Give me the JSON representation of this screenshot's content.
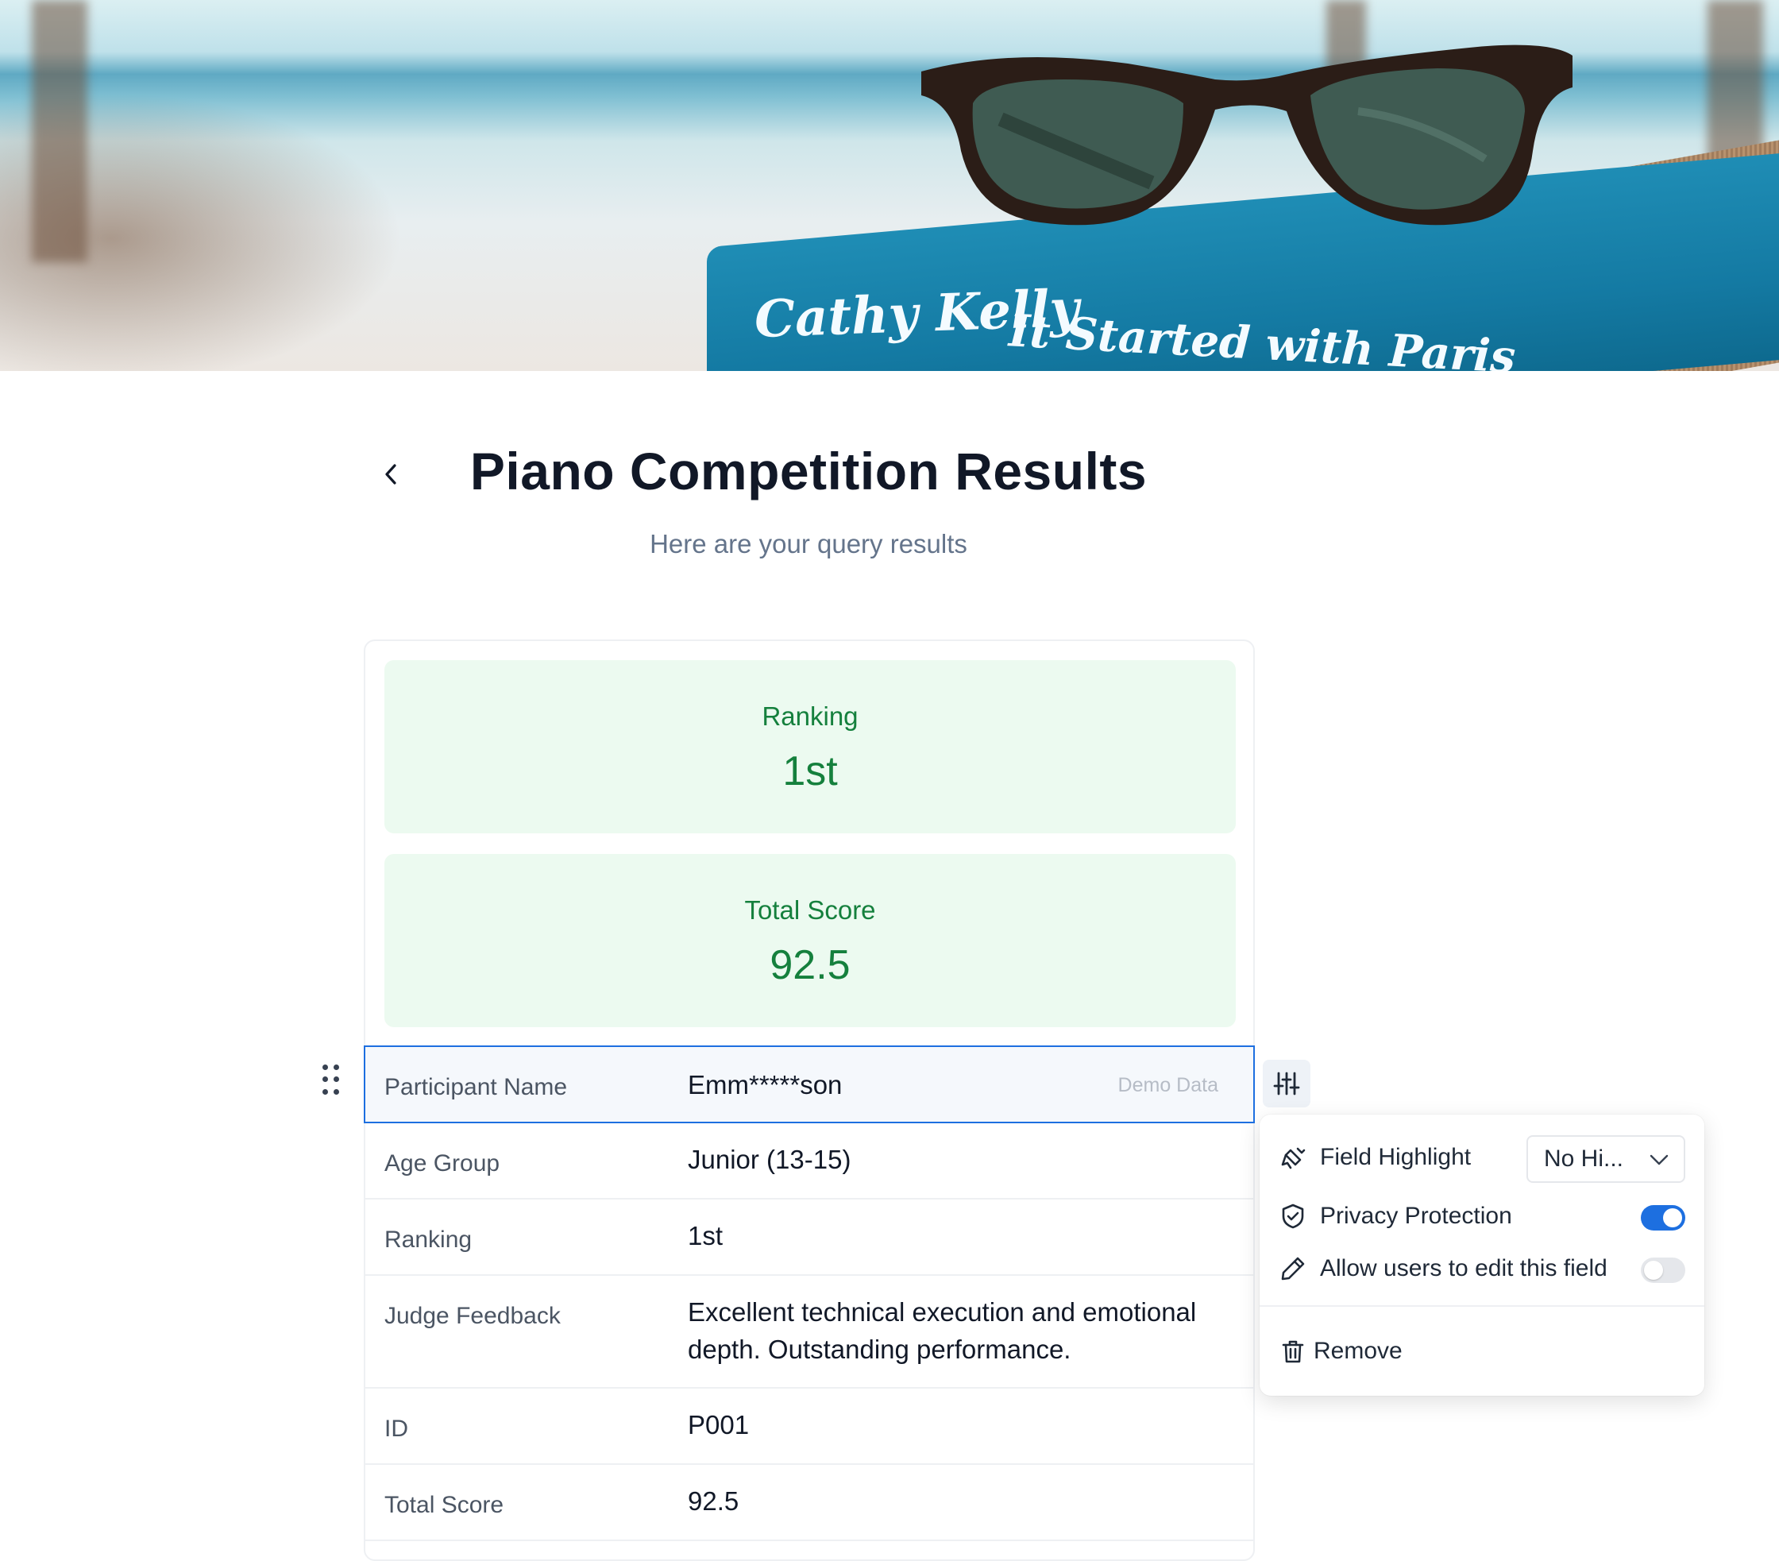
{
  "banner": {
    "book_author": "Cathy Kelly",
    "book_title": "It Started with Paris"
  },
  "header": {
    "title": "Piano Competition Results",
    "subtitle": "Here are your query results"
  },
  "stats": [
    {
      "label": "Ranking",
      "value": "1st"
    },
    {
      "label": "Total Score",
      "value": "92.5"
    }
  ],
  "fields": [
    {
      "label": "Participant Name",
      "value": "Emm*****son",
      "tag": "Demo Data"
    },
    {
      "label": "Age Group",
      "value": "Junior (13-15)"
    },
    {
      "label": "Ranking",
      "value": "1st"
    },
    {
      "label": "Judge Feedback",
      "value": "Excellent technical execution and emotional depth. Outstanding performance."
    },
    {
      "label": "ID",
      "value": "P001"
    },
    {
      "label": "Total Score",
      "value": "92.5"
    }
  ],
  "field_menu": {
    "field_highlight_label": "Field Highlight",
    "field_highlight_value": "No Hi...",
    "privacy_label": "Privacy Protection",
    "privacy_enabled": true,
    "edit_label": "Allow users to edit this field",
    "edit_enabled": false,
    "remove_label": "Remove"
  },
  "colors": {
    "accent": "#1d6fe0",
    "success": "#15803d",
    "success_bg": "#ecfaf0"
  }
}
